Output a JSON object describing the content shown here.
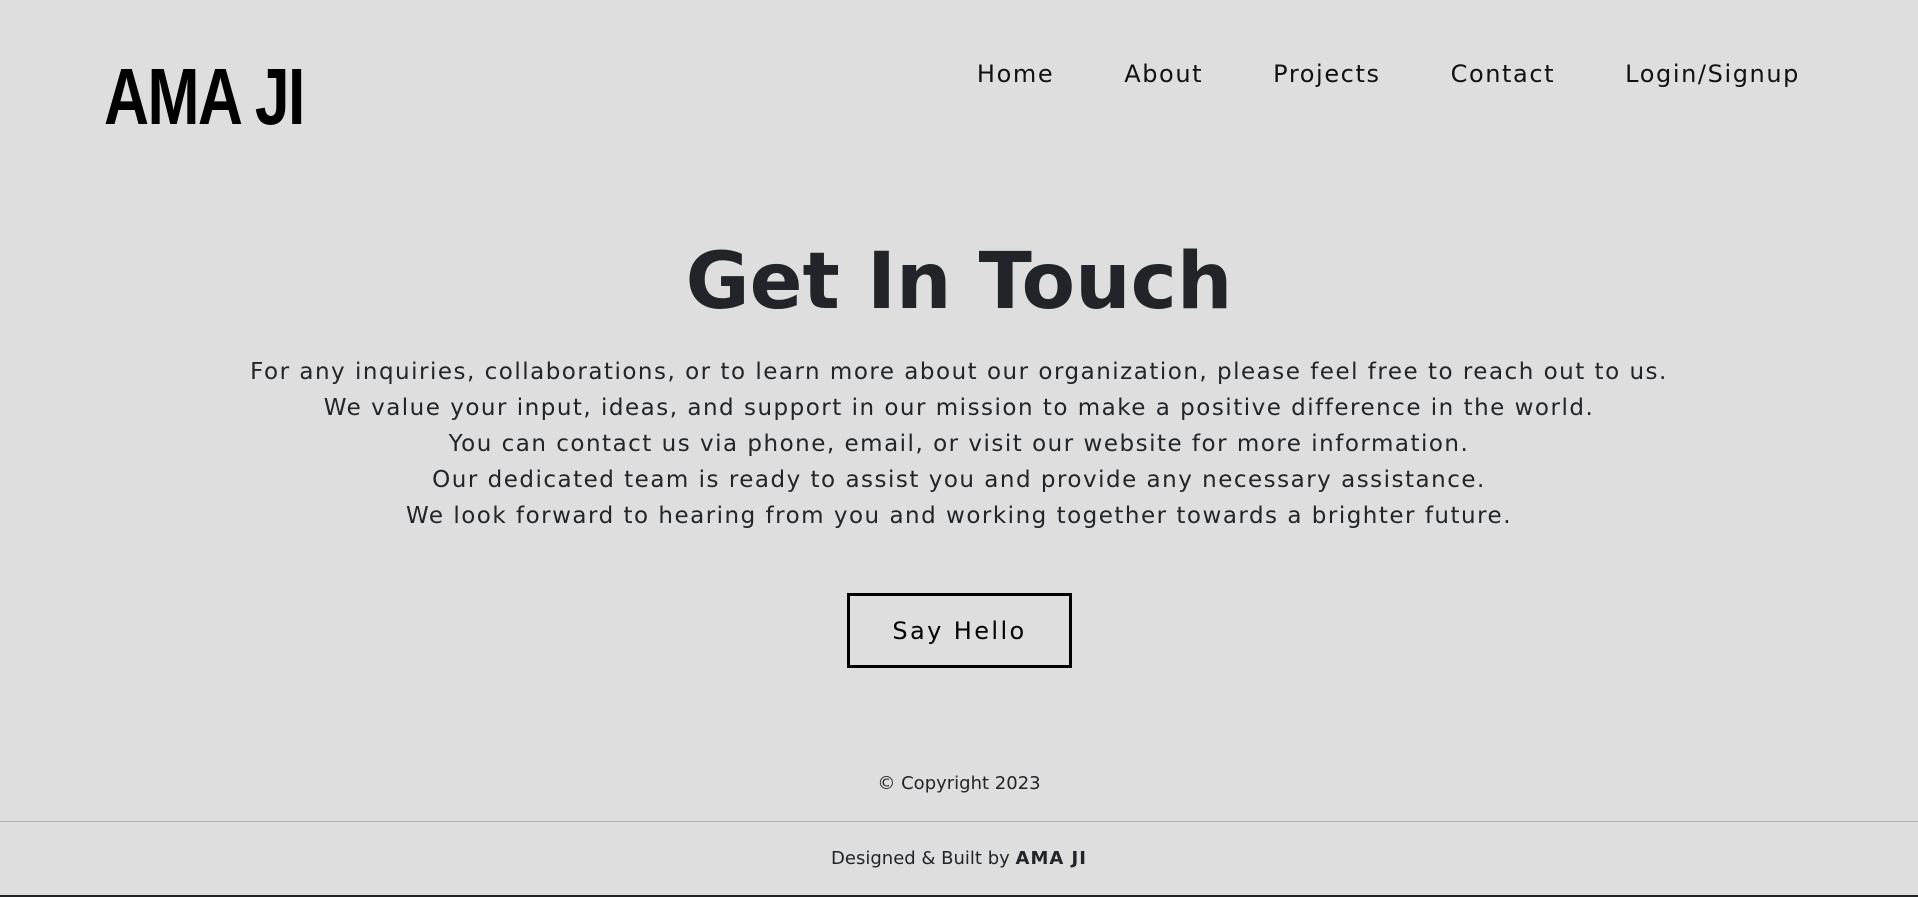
{
  "brand": {
    "logo_text": "AMA JI"
  },
  "nav": {
    "items": [
      {
        "label": "Home"
      },
      {
        "label": "About"
      },
      {
        "label": "Projects"
      },
      {
        "label": "Contact"
      },
      {
        "label": "Login/Signup"
      }
    ]
  },
  "hero": {
    "title": "Get In Touch",
    "paragraph_lines": [
      "For any inquiries, collaborations, or to learn more about our organization, please feel free to reach out to us.",
      "We value your input, ideas, and support in our mission to make a positive difference in the world.",
      "You can contact us via phone, email, or visit our website for more information.",
      "Our dedicated team is ready to assist you and provide any necessary assistance.",
      "We look forward to hearing from you and working together towards a brighter future."
    ],
    "cta_label": "Say Hello"
  },
  "footer": {
    "copyright": "© Copyright 2023",
    "credit_prefix": "Designed & Built by ",
    "credit_name": "AMA JI"
  },
  "colors": {
    "background": "#dedede",
    "text": "#212529",
    "accent": "#000000"
  }
}
